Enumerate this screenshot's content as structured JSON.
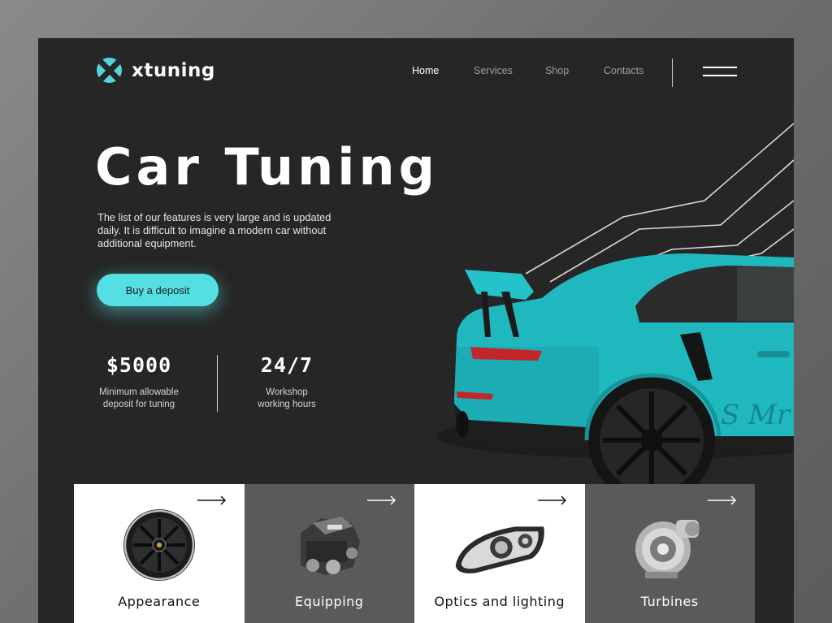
{
  "brand": {
    "name": "xtuning",
    "accent": "#54dfe4"
  },
  "nav": {
    "items": [
      {
        "label": "Home",
        "active": true
      },
      {
        "label": "Services",
        "active": false
      },
      {
        "label": "Shop",
        "active": false
      },
      {
        "label": "Contacts",
        "active": false
      }
    ],
    "menu_icon": "hamburger-menu-icon"
  },
  "hero": {
    "title": "Car Tuning",
    "description": "The list of our features is very large and is updated daily. It is difficult to imagine a modern car without additional equipment.",
    "cta_label": "Buy a deposit"
  },
  "stats": [
    {
      "value": "$5000",
      "label_line1": "Minimum allowable",
      "label_line2": "deposit for tuning"
    },
    {
      "value": "24/7",
      "label_line1": "Workshop",
      "label_line2": "working hours"
    }
  ],
  "categories": [
    {
      "label": "Appearance",
      "icon": "wheel-rim-icon",
      "theme": "light"
    },
    {
      "label": "Equipping",
      "icon": "engine-icon",
      "theme": "dark"
    },
    {
      "label": "Optics and lighting",
      "icon": "headlight-icon",
      "theme": "light"
    },
    {
      "label": "Turbines",
      "icon": "turbocharger-icon",
      "theme": "dark"
    }
  ]
}
